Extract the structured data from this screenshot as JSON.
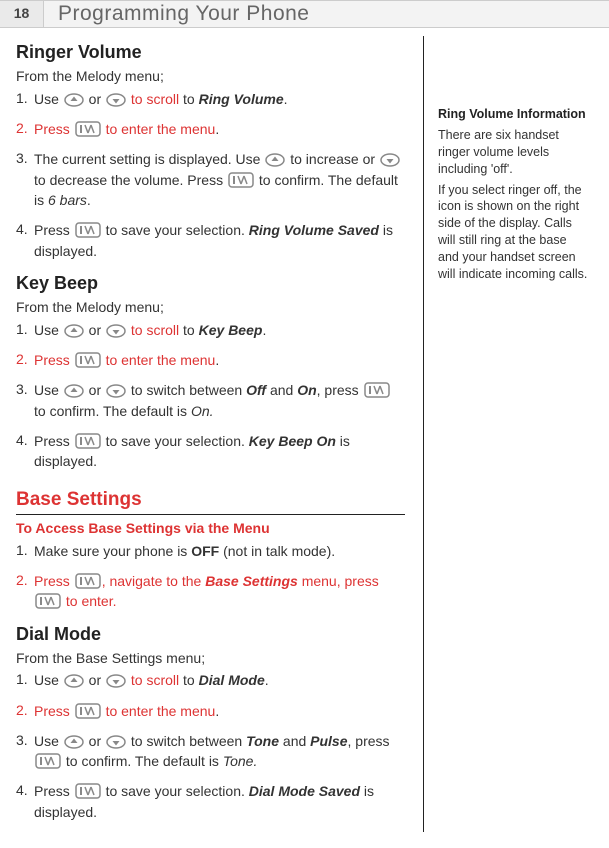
{
  "header": {
    "page_number": "18",
    "title": "Programming Your Phone"
  },
  "ringer_volume": {
    "heading": "Ringer Volume",
    "intro": "From the Melody menu;",
    "step1_a": "Use ",
    "step1_b": " or ",
    "step1_c": " to scroll",
    "step1_d": " to ",
    "step1_e": "Ring Volume",
    "step1_f": ".",
    "step2_a": "Press ",
    "step2_b": " to enter the menu",
    "step2_c": ".",
    "step3_a": "The current setting is displayed. Use ",
    "step3_b": " to increase or ",
    "step3_c": " to decrease the volume. Press ",
    "step3_d": " to confirm. The default is ",
    "step3_e": "6 bars",
    "step3_f": ".",
    "step4_a": "Press ",
    "step4_b": " to save your selection. ",
    "step4_c": "Ring Volume Saved",
    "step4_d": " is displayed."
  },
  "key_beep": {
    "heading": "Key Beep",
    "intro": "From the Melody menu;",
    "step1_a": "Use ",
    "step1_b": " or ",
    "step1_c": " to scroll",
    "step1_d": " to ",
    "step1_e": "Key Beep",
    "step1_f": ".",
    "step2_a": "Press ",
    "step2_b": " to enter the menu",
    "step2_c": ".",
    "step3_a": "Use ",
    "step3_b": " or ",
    "step3_c": " to switch between ",
    "step3_d": "Off",
    "step3_e": " and ",
    "step3_f": "On",
    "step3_g": ", press ",
    "step3_h": " to confirm. The default is ",
    "step3_i": "On.",
    "step4_a": "Press ",
    "step4_b": " to save your selection. ",
    "step4_c": "Key Beep On",
    "step4_d": " is displayed."
  },
  "base_settings": {
    "heading": "Base Settings",
    "access_heading": "To Access Base Settings via the Menu",
    "step1_a": "Make sure your phone is ",
    "step1_b": "OFF",
    "step1_c": " (not in talk mode).",
    "step2_a": "Press ",
    "step2_b": ", navigate to the ",
    "step2_c": "Base Settings",
    "step2_d": " menu, press ",
    "step2_e": " to enter."
  },
  "dial_mode": {
    "heading": "Dial Mode",
    "intro": "From the Base Settings menu;",
    "step1_a": "Use ",
    "step1_b": " or ",
    "step1_c": " to scroll",
    "step1_d": " to ",
    "step1_e": "Dial Mode",
    "step1_f": ".",
    "step2_a": "Press ",
    "step2_b": " to enter the menu",
    "step2_c": ".",
    "step3_a": "Use ",
    "step3_b": " or ",
    "step3_c": " to switch between ",
    "step3_d": "Tone",
    "step3_e": " and ",
    "step3_f": "Pulse",
    "step3_g": ", press  ",
    "step3_h": " to confirm. The default is ",
    "step3_i": "Tone.",
    "step4_a": "Press ",
    "step4_b": " to save your selection. ",
    "step4_c": "Dial Mode Saved",
    "step4_d": " is displayed."
  },
  "sidebar": {
    "title": "Ring Volume Information",
    "p1": "There are six handset ringer volume levels including 'off'.",
    "p2": "If you select ringer off, the icon is shown on the right side of the display. Calls will still ring at the base and your handset screen will indicate incoming calls."
  },
  "nums": {
    "n1": "1.",
    "n2": "2.",
    "n3": "3.",
    "n4": "4."
  }
}
